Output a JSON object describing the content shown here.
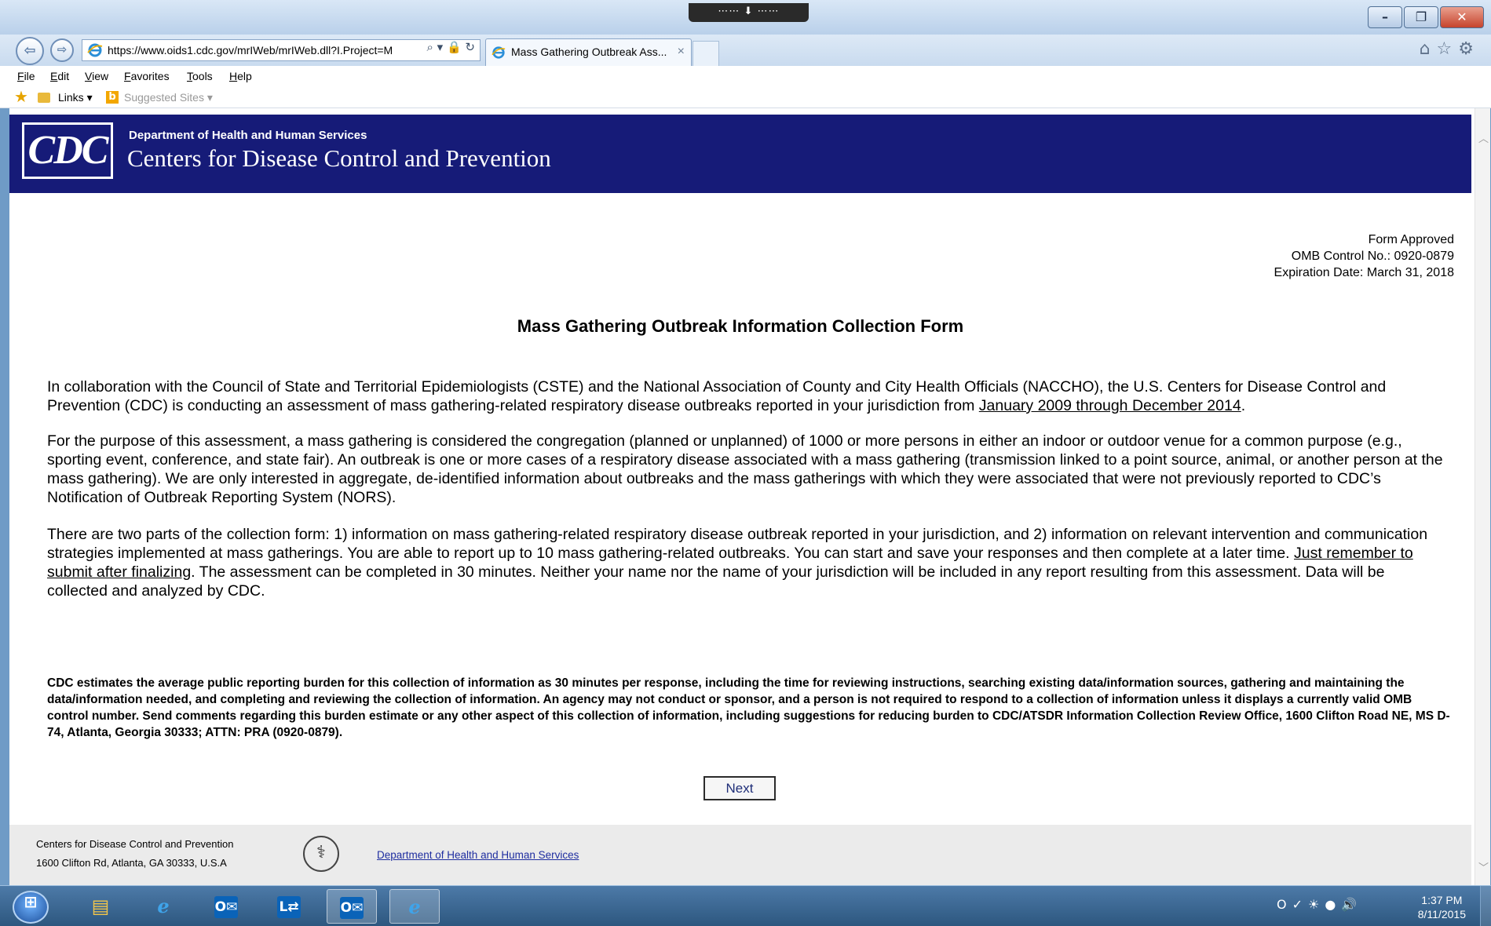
{
  "browser": {
    "url": "https://www.oids1.cdc.gov/mrIWeb/mrIWeb.dll?I.Project=M",
    "tab_title": "Mass Gathering Outbreak Ass...",
    "tab_close": "×",
    "addr_tools": "⌕ ▾ 🔒 ↻",
    "grip": "⋯⋯ ⬇ ⋯⋯",
    "window_buttons": {
      "minimize": "–",
      "maximize": "❐",
      "close": "✕"
    },
    "chrome_icons": "⌂☆⚙",
    "menu": [
      "File",
      "Edit",
      "View",
      "Favorites",
      "Tools",
      "Help"
    ],
    "favorites": {
      "links": "Links ▾",
      "suggested": "Suggested Sites ▾"
    }
  },
  "header": {
    "logo": "CDC",
    "dept": "Department of Health and Human Services",
    "org": "Centers for Disease Control and Prevention"
  },
  "omb": {
    "line1": "Form Approved",
    "line2": "OMB Control No.: 0920-0879",
    "line3": "Expiration Date: March 31, 2018"
  },
  "form": {
    "title": "Mass Gathering Outbreak Information Collection Form",
    "p1_a": "In collaboration with the Council of State and Territorial Epidemiologists (CSTE) and the National Association of County and City Health Officials (NACCHO), the U.S. Centers for Disease Control and Prevention (CDC) is conducting an assessment of mass gathering-related respiratory disease outbreaks reported in your jurisdiction from ",
    "p1_underline": "January 2009 through December 2014",
    "p1_b": ".",
    "p2": "For the purpose of this assessment, a mass gathering is considered the congregation (planned or unplanned) of 1000 or more persons in either an indoor or outdoor venue for a common purpose (e.g., sporting event, conference, and state fair). An outbreak is one or more cases of a respiratory disease associated with a mass gathering (transmission linked to a point source, animal, or another person at the mass gathering). We are only interested in aggregate, de-identified information about outbreaks and the mass gatherings with which they were associated that were not previously reported to CDC’s Notification of Outbreak Reporting System (NORS).",
    "p3_a": "There are two parts of the collection form: 1) information on mass gathering-related respiratory disease outbreak reported in your jurisdiction, and 2) information on relevant intervention and communication strategies implemented at mass gatherings. You are able to report up to 10 mass gathering-related outbreaks. You can start and save your responses and then complete at a later time. ",
    "p3_underline": "Just remember to submit after finalizing",
    "p3_b": ". The assessment can be completed in 30 minutes. Neither your name nor the name of your jurisdiction will be included in any report resulting from this assessment. Data will be collected and analyzed by CDC.",
    "burden": "CDC estimates the average public reporting burden for this collection of information as 30 minutes per response, including the time for reviewing instructions, searching existing data/information sources, gathering and maintaining the data/information needed, and completing and reviewing the collection of information. An agency may not conduct or sponsor, and a person is not required to respond to a collection of information unless it displays a currently valid OMB control number. Send comments regarding this burden estimate or any other aspect of this collection of information, including suggestions for reducing burden to CDC/ATSDR Information Collection Review Office, 1600 Clifton Road NE, MS D-74, Atlanta, Georgia 30333; ATTN: PRA (0920-0879).",
    "next_label": "Next"
  },
  "footer": {
    "org": "Centers for Disease Control and Prevention",
    "address": "1600 Clifton Rd, Atlanta, GA 30333, U.S.A",
    "hhs_link": "Department of Health and Human Services"
  },
  "taskbar": {
    "outlook_glyph": "O✉",
    "lync_glyph": "L⇄",
    "tray": "O✓☀●🔊",
    "time": "1:37 PM",
    "date": "8/11/2015"
  }
}
